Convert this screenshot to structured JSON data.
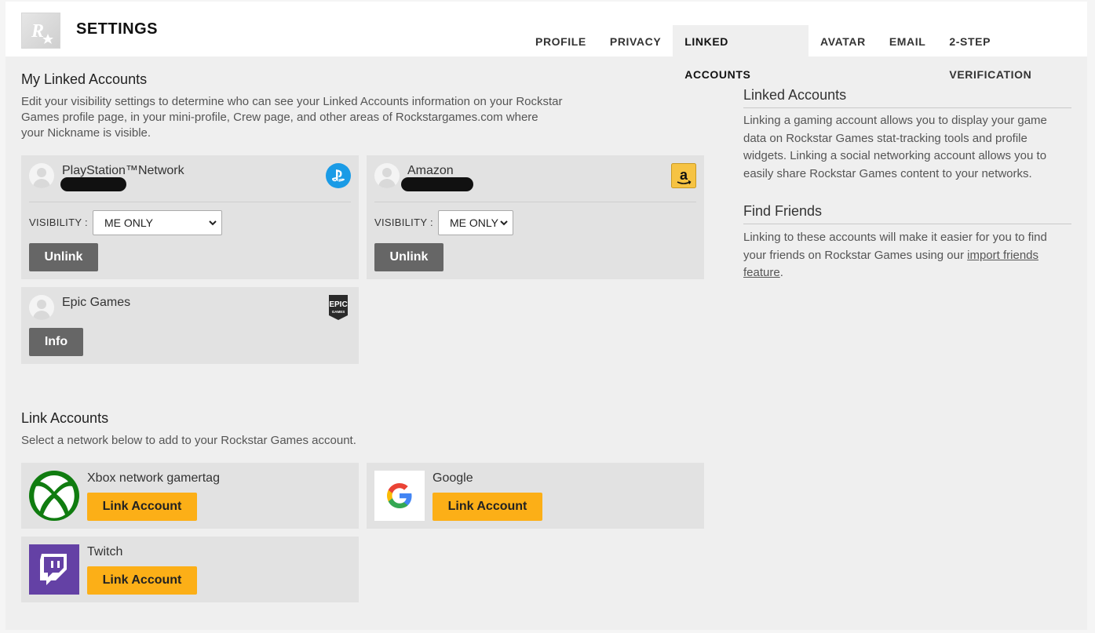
{
  "header": {
    "title": "SETTINGS",
    "tabs": [
      {
        "label": "PROFILE",
        "active": false
      },
      {
        "label": "PRIVACY",
        "active": false
      },
      {
        "label": "LINKED ACCOUNTS",
        "active": true
      },
      {
        "label": "AVATAR",
        "active": false
      },
      {
        "label": "EMAIL",
        "active": false
      },
      {
        "label": "2-STEP VERIFICATION",
        "active": false
      }
    ]
  },
  "my_linked": {
    "title": "My Linked Accounts",
    "description": "Edit your visibility settings to determine who can see your Linked Accounts information on your Rockstar Games profile page, in your mini-profile, Crew page, and other areas of Rockstargames.com where your Nickname is visible.",
    "accounts": [
      {
        "network": "PlayStation™Network",
        "icon": "playstation-icon",
        "visibility_label": "VISIBILITY :",
        "visibility_value": "ME ONLY",
        "button": "Unlink"
      },
      {
        "network": "Amazon",
        "icon": "amazon-icon",
        "visibility_label": "VISIBILITY :",
        "visibility_value": "ME ONLY",
        "button": "Unlink"
      },
      {
        "network": "Epic Games",
        "icon": "epic-games-icon",
        "button": "Info"
      }
    ]
  },
  "link_accounts": {
    "title": "Link Accounts",
    "description": "Select a network below to add to your Rockstar Games account.",
    "networks": [
      {
        "name": "Xbox network gamertag",
        "icon": "xbox-icon",
        "button": "Link Account"
      },
      {
        "name": "Google",
        "icon": "google-icon",
        "button": "Link Account"
      },
      {
        "name": "Twitch",
        "icon": "twitch-icon",
        "button": "Link Account"
      }
    ]
  },
  "sidebar": {
    "linked_title": "Linked Accounts",
    "linked_text": "Linking a gaming account allows you to display your game data on Rockstar Games stat-tracking tools and profile widgets. Linking a social networking account allows you to easily share Rockstar Games content to your networks.",
    "friends_title": "Find Friends",
    "friends_text": "Linking to these accounts will make it easier for you to find your friends on Rockstar Games using our",
    "friends_link": "import friends feature",
    "friends_end": "."
  },
  "colors": {
    "accent": "#fcaf17",
    "button_dark": "#666666",
    "card_bg": "#e2e2e2",
    "page_bg": "#efefef"
  }
}
